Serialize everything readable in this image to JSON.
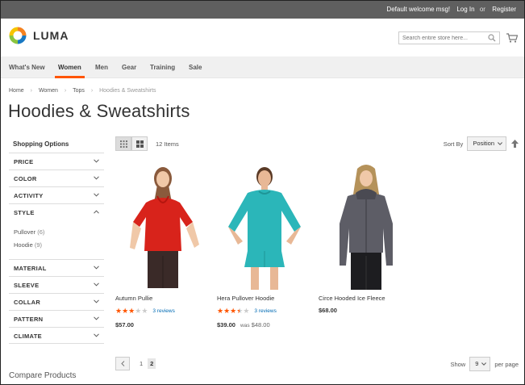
{
  "topbar": {
    "welcome": "Default welcome msg!",
    "login": "Log In",
    "or": "or",
    "register": "Register"
  },
  "header": {
    "logo_text": "LUMA",
    "search_placeholder": "Search entire store here..."
  },
  "nav": {
    "items": [
      {
        "label": "What's New"
      },
      {
        "label": "Women"
      },
      {
        "label": "Men"
      },
      {
        "label": "Gear"
      },
      {
        "label": "Training"
      },
      {
        "label": "Sale"
      }
    ],
    "active": "Women"
  },
  "breadcrumbs": {
    "home": "Home",
    "women": "Women",
    "tops": "Tops",
    "current": "Hoodies & Sweatshirts",
    "sep": "›"
  },
  "page": {
    "title": "Hoodies & Sweatshirts"
  },
  "sidebar": {
    "title": "Shopping Options",
    "filters_top": [
      "PRICE",
      "COLOR",
      "ACTIVITY"
    ],
    "style_label": "STYLE",
    "style_options": [
      {
        "label": "Pullover",
        "count": "(6)"
      },
      {
        "label": "Hoodie",
        "count": "(9)"
      }
    ],
    "filters_bottom": [
      "MATERIAL",
      "SLEEVE",
      "COLLAR",
      "PATTERN",
      "CLIMATE"
    ],
    "compare_title": "Compare Products"
  },
  "toolbar": {
    "items_count": "12 Items",
    "sort_label": "Sort By",
    "sort_value": "Position",
    "show_label": "Show",
    "limit_value": "9",
    "per_page_label": "per page",
    "pages": [
      "1",
      "2"
    ],
    "current_page": "2"
  },
  "products": [
    {
      "name": "Autumn Pullie",
      "rating": 3,
      "reviews": "3 reviews",
      "price": "$57.00",
      "color": "#d8231b"
    },
    {
      "name": "Hera Pullover Hoodie",
      "rating": 3.5,
      "reviews": "3 reviews",
      "price": "$39.00",
      "was_label": "was",
      "was_price": "$48.00",
      "color": "#2bb6b9"
    },
    {
      "name": "Circe Hooded Ice Fleece",
      "price": "$68.00",
      "color": "#5d5d66"
    }
  ],
  "colors": {
    "accent": "#ff5501",
    "topbar": "#5f5f5f",
    "link": "#006bb4"
  }
}
